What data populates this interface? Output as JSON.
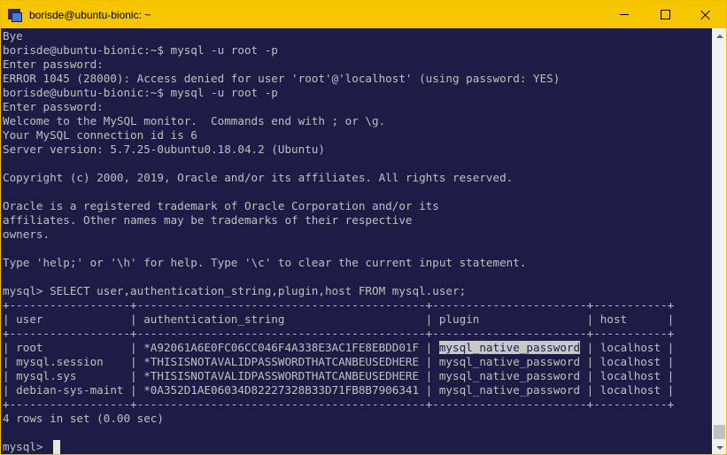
{
  "window": {
    "title": "borisde@ubuntu-bionic: ~"
  },
  "terminal": {
    "lines": [
      "Bye",
      "borisde@ubuntu-bionic:~$ mysql -u root -p",
      "Enter password:",
      "ERROR 1045 (28000): Access denied for user 'root'@'localhost' (using password: YES)",
      "borisde@ubuntu-bionic:~$ mysql -u root -p",
      "Enter password:",
      "Welcome to the MySQL monitor.  Commands end with ; or \\g.",
      "Your MySQL connection id is 6",
      "Server version: 5.7.25-0ubuntu0.18.04.2 (Ubuntu)",
      "",
      "Copyright (c) 2000, 2019, Oracle and/or its affiliates. All rights reserved.",
      "",
      "Oracle is a registered trademark of Oracle Corporation and/or its",
      "affiliates. Other names may be trademarks of their respective",
      "owners.",
      "",
      "Type 'help;' or '\\h' for help. Type '\\c' to clear the current input statement.",
      "",
      "mysql> SELECT user,authentication_string,plugin,host FROM mysql.user;",
      "+------------------+-------------------------------------------+-----------------------+-----------+",
      "| user             | authentication_string                     | plugin                | host      |",
      "+------------------+-------------------------------------------+-----------------------+-----------+",
      "",
      "| mysql.session    | *THISISNOTAVALIDPASSWORDTHATCANBEUSEDHERE | mysql_native_password | localhost |",
      "| mysql.sys        | *THISISNOTAVALIDPASSWORDTHATCANBEUSEDHERE | mysql_native_password | localhost |",
      "| debian-sys-maint | *0A352D1AE06034D82227328B33D71FB8B7906341 | mysql_native_password | localhost |",
      "+------------------+-------------------------------------------+-----------------------+-----------+",
      "4 rows in set (0.00 sec)",
      "",
      "mysql> "
    ],
    "root_row": {
      "before": "| root             | *A92061A6E0FC06CC046F4A338E3AC1FE8EBDD01F | ",
      "highlight": "mysql_native_password",
      "after": " | localhost |"
    }
  }
}
